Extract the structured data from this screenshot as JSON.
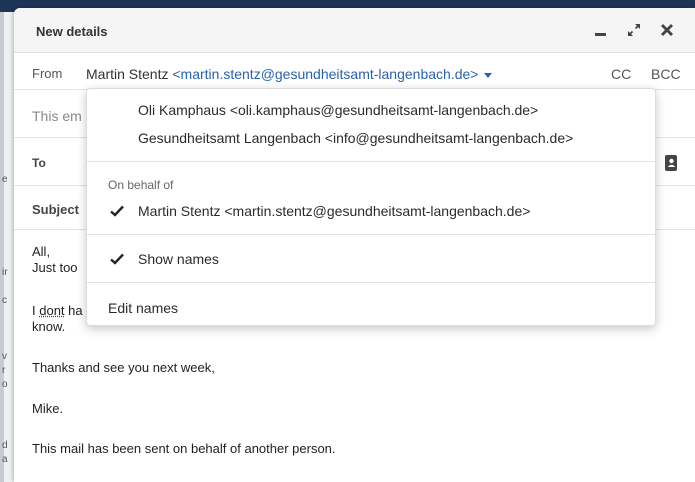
{
  "dialog": {
    "title": "New details"
  },
  "from": {
    "label": "From",
    "name": "Martin Stentz",
    "email": "<martin.stentz@gesundheitsamt-langenbach.de>",
    "cc_label": "CC",
    "bcc_label": "BCC"
  },
  "hidden_rows": {
    "this_row_fragment": "This em",
    "to_label": "To",
    "subject_fragment": "Subject"
  },
  "body_lines": {
    "line1": "All,",
    "line2_fragment": "Just too",
    "line3_word": "dont",
    "line3_prefix": "I ",
    "line3_fragment": " ha",
    "line4": "know.",
    "line5": "Thanks and see you next week,",
    "line6": "Mike.",
    "line7": "This mail has been sent on behalf of another person."
  },
  "dropdown": {
    "addresses": [
      "Oli Kamphaus <oli.kamphaus@gesundheitsamt-langenbach.de>",
      "Gesundheitsamt Langenbach <info@gesundheitsamt-langenbach.de>"
    ],
    "on_behalf_header": "On behalf of",
    "on_behalf_selected": "Martin Stentz <martin.stentz@gesundheitsamt-langenbach.de>",
    "show_names": "Show names",
    "edit_names": "Edit names"
  },
  "edge_fragments": [
    "e",
    "ir",
    "c",
    "v",
    "r",
    "o",
    "d",
    "a"
  ],
  "colors": {
    "link_blue": "#2a62b0",
    "header_bg": "#f5f5f5",
    "top_bar": "#1e3457"
  },
  "icons": [
    "minimize-icon",
    "expand-icon",
    "close-icon",
    "address-book-icon",
    "check-icon"
  ]
}
